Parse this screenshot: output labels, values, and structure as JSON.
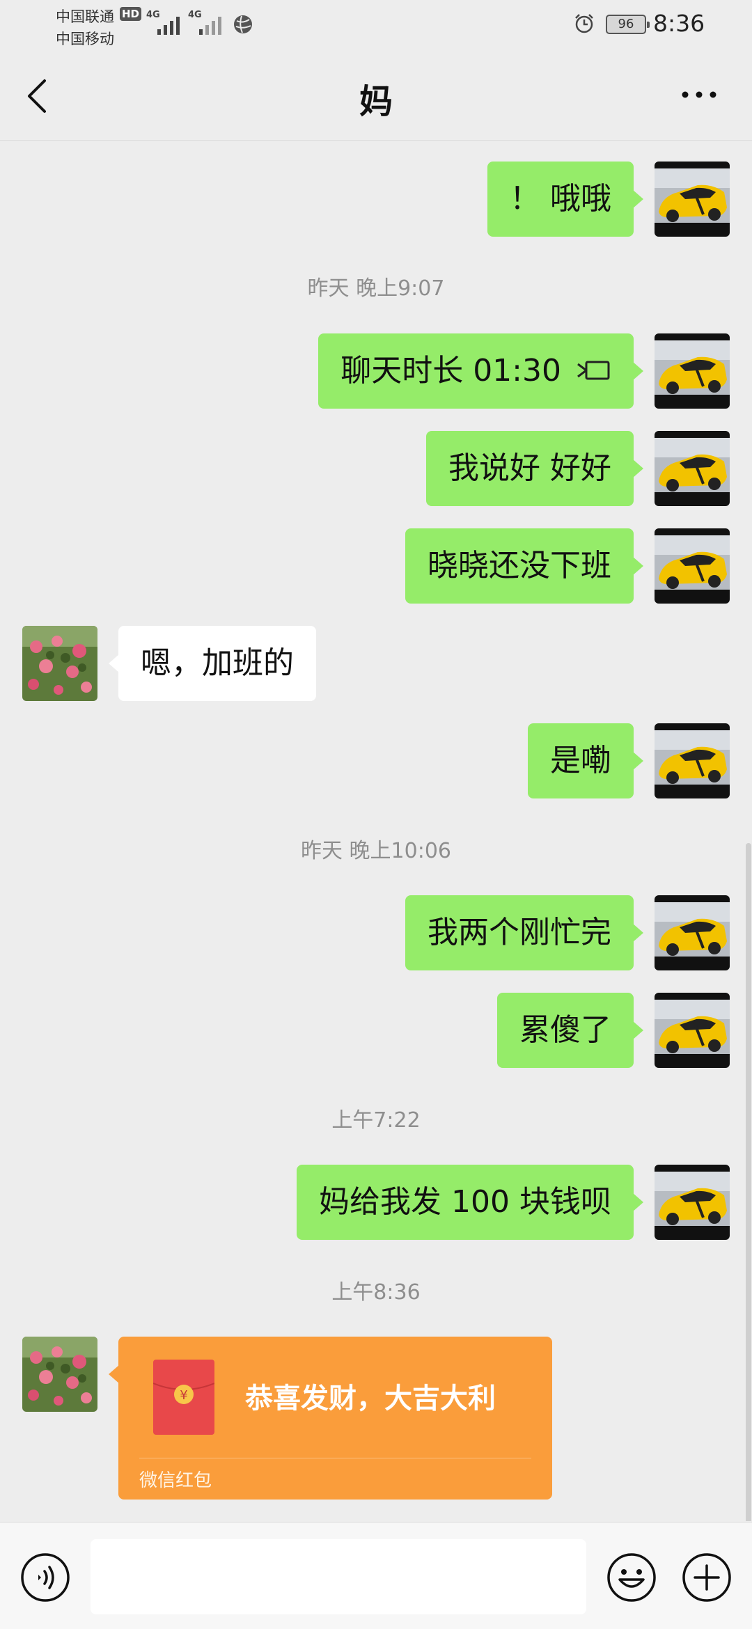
{
  "status_bar": {
    "carrier_1": "中国联通",
    "carrier_2": "中国移动",
    "hd_badge": "HD",
    "network_1": "4G",
    "network_2": "4G",
    "battery": "96",
    "time": "8:36"
  },
  "header": {
    "title": "妈",
    "back_icon": "chevron-left-icon",
    "more_icon": "more-dots-icon"
  },
  "messages": [
    {
      "side": "out",
      "text": "！ 哦哦"
    },
    {
      "type": "time",
      "text": "昨天 晚上9:07"
    },
    {
      "side": "out",
      "text": "聊天时长 01:30",
      "icon": "video-call-icon"
    },
    {
      "side": "out",
      "text": "我说好 好好"
    },
    {
      "side": "out",
      "text": "晓晓还没下班"
    },
    {
      "side": "in",
      "text": "嗯，加班的"
    },
    {
      "side": "out",
      "text": "是嘞"
    },
    {
      "type": "time",
      "text": "昨天 晚上10:06"
    },
    {
      "side": "out",
      "text": "我两个刚忙完"
    },
    {
      "side": "out",
      "text": "累傻了"
    },
    {
      "type": "time",
      "text": "上午7:22"
    },
    {
      "side": "out",
      "text": "妈给我发 100 块钱呗"
    },
    {
      "type": "time",
      "text": "上午8:36"
    }
  ],
  "red_packet": {
    "greeting": "恭喜发财，大吉大利",
    "label": "微信红包",
    "icon": "red-envelope-icon"
  },
  "input_bar": {
    "placeholder": "",
    "voice_icon": "voice-icon",
    "emoji_icon": "emoji-icon",
    "plus_icon": "plus-icon"
  },
  "colors": {
    "background": "#ededed",
    "outgoing_bubble": "#95ec69",
    "incoming_bubble": "#ffffff",
    "red_packet": "#fa9d3b"
  }
}
